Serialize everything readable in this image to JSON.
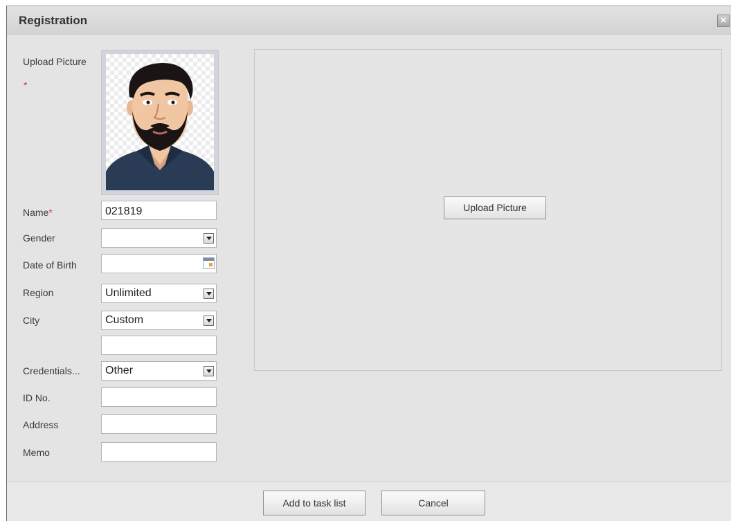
{
  "dialog": {
    "title": "Registration",
    "close_glyph": "×"
  },
  "form": {
    "upload_label": "Upload Picture",
    "required_mark": "*",
    "name_label": "Name",
    "name_value": "021819",
    "gender_label": "Gender",
    "gender_value": "",
    "dob_label": "Date of Birth",
    "dob_value": "",
    "region_label": "Region",
    "region_value": "Unlimited",
    "city_label": "City",
    "city_value": "Custom",
    "city_custom_value": "",
    "credentials_label": "Credentials...",
    "credentials_value": "Other",
    "id_label": "ID No.",
    "id_value": "",
    "address_label": "Address",
    "address_value": "",
    "memo_label": "Memo",
    "memo_value": ""
  },
  "preview": {
    "upload_button": "Upload Picture"
  },
  "footer": {
    "add_button": "Add to task list",
    "cancel_button": "Cancel"
  },
  "icons": {
    "close": "close-icon",
    "dropdown": "chevron-down-icon",
    "calendar": "calendar-icon",
    "avatar": "avatar"
  },
  "colors": {
    "required": "#d9362b",
    "dialog_bg": "#e4e4e4"
  }
}
